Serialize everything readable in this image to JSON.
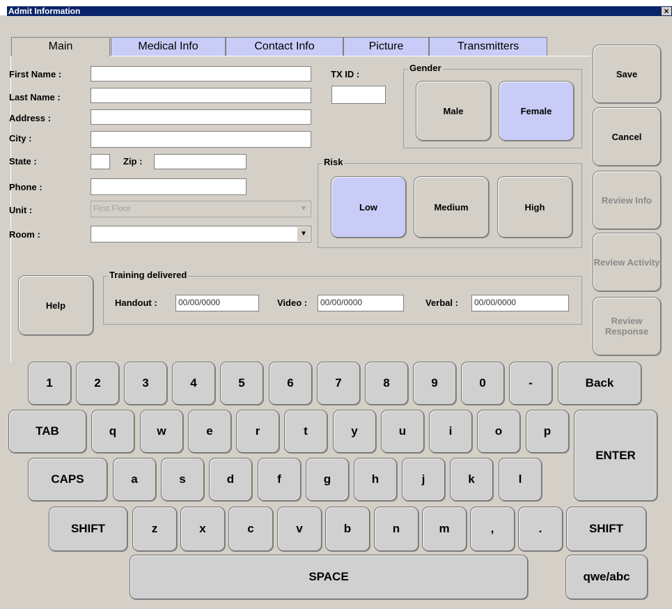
{
  "window": {
    "title": "Admit Information",
    "close": "×"
  },
  "tabs": [
    "Main",
    "Medical Info",
    "Contact Info",
    "Picture",
    "Transmitters"
  ],
  "form": {
    "first_name_label": "First Name :",
    "first_name_value": "",
    "last_name_label": "Last Name :",
    "last_name_value": "",
    "address_label": "Address :",
    "address_value": "",
    "city_label": "City :",
    "city_value": "",
    "state_label": "State :",
    "state_value": "",
    "zip_label": "Zip :",
    "zip_value": "",
    "phone_label": "Phone :",
    "phone_value": "",
    "unit_label": "Unit :",
    "unit_value": "First Floor",
    "room_label": "Room :",
    "room_value": "",
    "txid_label": "TX ID :",
    "txid_value": ""
  },
  "gender": {
    "title": "Gender",
    "male": "Male",
    "female": "Female",
    "selected": "Female"
  },
  "risk": {
    "title": "Risk",
    "low": "Low",
    "medium": "Medium",
    "high": "High",
    "selected": "Low"
  },
  "training": {
    "title": "Training delivered",
    "handout_label": "Handout :",
    "handout_value": "00/00/0000",
    "video_label": "Video :",
    "video_value": "00/00/0000",
    "verbal_label": "Verbal :",
    "verbal_value": "00/00/0000"
  },
  "help_label": "Help",
  "side_buttons": {
    "save": "Save",
    "cancel": "Cancel",
    "review_info": "Review Info",
    "review_activity": "Review Activity",
    "review_response": "Review Response"
  },
  "keyboard": {
    "row1": [
      "1",
      "2",
      "3",
      "4",
      "5",
      "6",
      "7",
      "8",
      "9",
      "0",
      "-",
      "Back"
    ],
    "row2": [
      "TAB",
      "q",
      "w",
      "e",
      "r",
      "t",
      "y",
      "u",
      "i",
      "o",
      "p"
    ],
    "row3": [
      "CAPS",
      "a",
      "s",
      "d",
      "f",
      "g",
      "h",
      "j",
      "k",
      "l"
    ],
    "row4": [
      "SHIFT",
      "z",
      "x",
      "c",
      "v",
      "b",
      "n",
      "m",
      ",",
      ".",
      "SHIFT"
    ],
    "enter": "ENTER",
    "space": "SPACE",
    "layout_toggle": "qwe/abc"
  },
  "colors": {
    "title_bar": "#0a246a",
    "selected": "#c8ccf6",
    "background": "#d4d0c8"
  }
}
